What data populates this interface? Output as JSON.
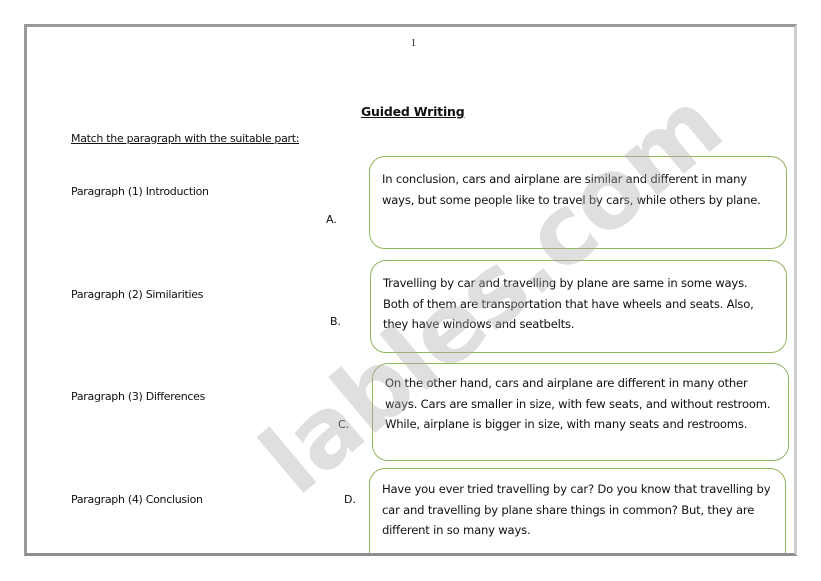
{
  "document": {
    "page_number": "1",
    "title": "Guided Writing",
    "instructions": "Match the paragraph with the suitable part:"
  },
  "paragraphs": [
    {
      "label": "Paragraph (1) Introduction"
    },
    {
      "label": "Paragraph (2) Similarities"
    },
    {
      "label": "Paragraph (3) Differences"
    },
    {
      "label": "Paragraph (4) Conclusion"
    }
  ],
  "parts": [
    {
      "letter": "A.",
      "text": "In conclusion, cars and airplane are similar and different in many ways, but some people like to travel by cars, while others by plane."
    },
    {
      "letter": "B.",
      "text": "Travelling by car and travelling by plane are same in some ways. Both of them are transportation that have wheels and seats. Also, they have windows and seatbelts."
    },
    {
      "letter": "C.",
      "text": "On the other hand, cars and airplane are different in many other ways. Cars are smaller in size, with few seats, and without restroom. While, airplane is bigger in size, with many seats and restrooms."
    },
    {
      "letter": "D.",
      "text": "Have you ever tried travelling by car? Do you know that travelling by car and travelling by plane share things in common? But, they are different in so many ways."
    }
  ],
  "watermark": "lables.com",
  "colors": {
    "box_border": "#93b55f",
    "page_border": "#9a9a9a"
  }
}
